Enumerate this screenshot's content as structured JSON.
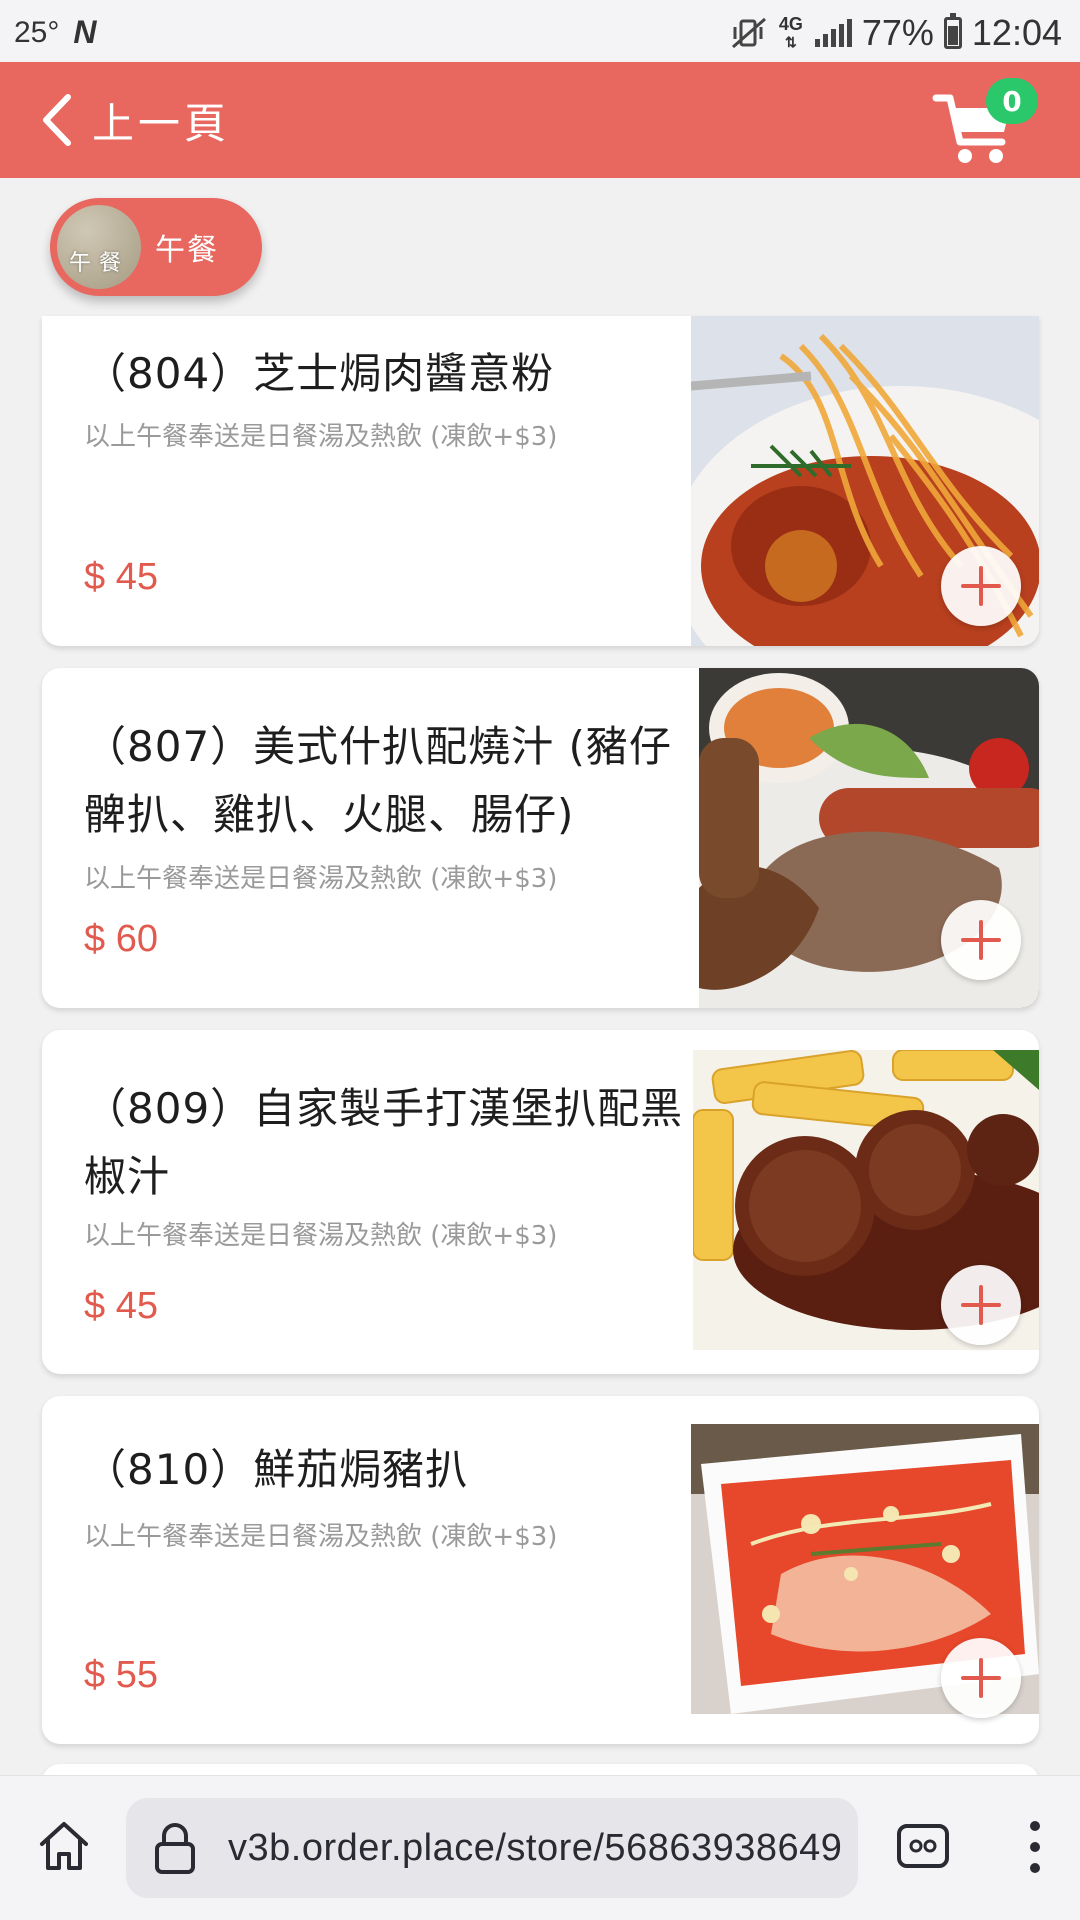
{
  "status_bar": {
    "temperature": "25°",
    "network": "4G",
    "battery": "77%",
    "time": "12:04"
  },
  "header": {
    "back_label": "上一頁",
    "cart_count": "0"
  },
  "category": {
    "label": "午餐",
    "thumb_text": "午餐"
  },
  "menu": {
    "items": [
      {
        "title": "（804）芝士焗肉醬意粉",
        "description": "以上午餐奉送是日餐湯及熱飲 (凍飲+$3)",
        "price": "$ 45",
        "image": "spaghetti-bolognese"
      },
      {
        "title": "（807）美式什扒配燒汁 (豬仔髀扒、雞扒、火腿、腸仔)",
        "description": "以上午餐奉送是日餐湯及熱飲 (凍飲+$3)",
        "price": "$ 60",
        "image": "mixed-grill"
      },
      {
        "title": "（809）自家製手打漢堡扒配黑椒汁",
        "description": "以上午餐奉送是日餐湯及熱飲 (凍飲+$3)",
        "price": "$ 45",
        "image": "hamburger-steak"
      },
      {
        "title": "（810）鮮茄焗豬扒",
        "description": "以上午餐奉送是日餐湯及熱飲 (凍飲+$3)",
        "price": "$ 55",
        "image": "baked-pork-chop-tomato"
      }
    ]
  },
  "browser": {
    "url": "v3b.order.place/store/56863938649"
  },
  "colors": {
    "accent": "#e8675f",
    "price": "#e25a4e",
    "badge": "#2bc86b"
  }
}
